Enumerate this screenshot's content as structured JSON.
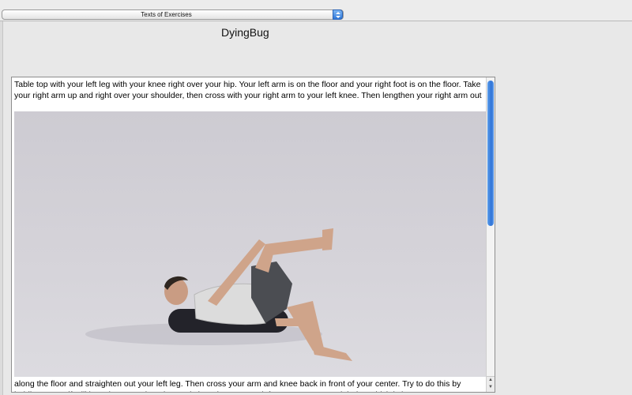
{
  "toolbar": {
    "popup_selected": "Texts of Exercises",
    "popup_icon": "up-down-arrows-icon"
  },
  "exercise": {
    "title": "DyingBug",
    "text_before_photo": " Table top with your left leg with your knee right over your hip.  Your left arm is on the floor and your right foot is on the floor.  Take your right arm up and right over your shoulder, then cross with your right arm to your left knee.  Then lengthen your right arm out",
    "text_after_photo": "along the floor and straighten out your left leg.  Then cross your arm and knee back in front of your center.  Try to do this by holding yourself still by using your abs.  Then switch and cross your left arm over to your right leg which is in",
    "photo_icon": "exercise-photo"
  },
  "scrollbar": {
    "position": 0.02,
    "icons": [
      "scroll-up-arrow-icon",
      "scroll-down-arrow-icon"
    ]
  },
  "colors": {
    "accent": "#3478d6",
    "window_bg": "#e8e8e8",
    "photo_bg": "#d3d1d7"
  }
}
